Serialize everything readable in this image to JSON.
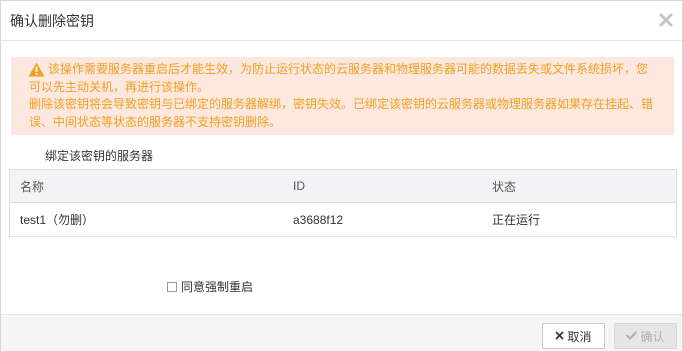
{
  "dialog": {
    "title": "确认删除密钥"
  },
  "alert": {
    "line1": "该操作需要服务器重启后才能生效，为防止运行状态的云服务器和物理服务器可能的数据丢失或文件系统损坏，您可以先主动关机，再进行该操作。",
    "line2": "删除该密钥将会导致密钥与已绑定的服务器解绑，密钥失效。已绑定该密钥的云服务器或物理服务器如果存在挂起、错误、中间状态等状态的服务器不支持密钥删除。",
    "color": "#f0a020",
    "background": "#fde8df"
  },
  "section": {
    "label": "绑定该密钥的服务器"
  },
  "table": {
    "headers": [
      "名称",
      "ID",
      "状态"
    ],
    "rows": [
      {
        "name": "test1（勿删）",
        "id": "a3688f12",
        "status": "正在运行"
      }
    ]
  },
  "agree": {
    "label": "同意强制重启",
    "checked": false
  },
  "footer": {
    "cancel_label": "取消",
    "confirm_label": "确认"
  },
  "icons": {
    "close": "close-icon",
    "warning": "warning-icon",
    "cancel": "x-icon",
    "confirm": "check-icon"
  }
}
